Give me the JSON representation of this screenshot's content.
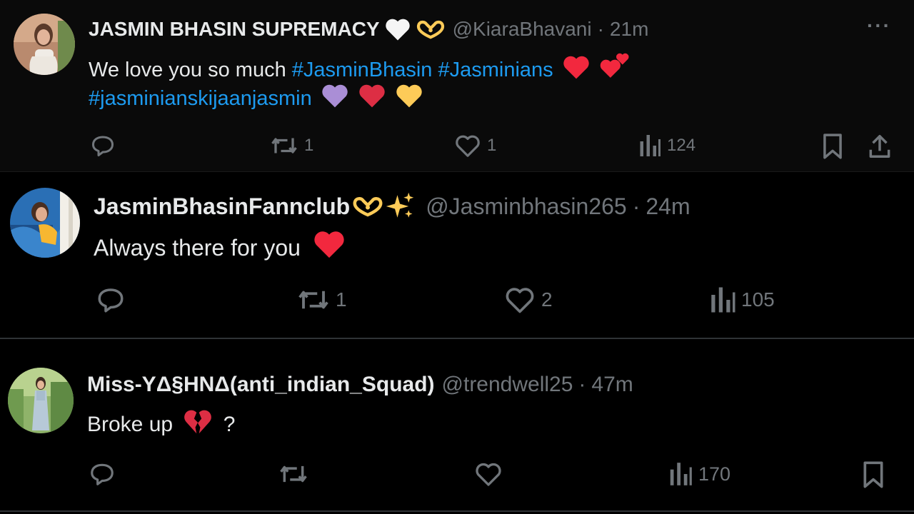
{
  "tweets": [
    {
      "name": "JASMIN BHASIN SUPREMACY",
      "name_emojis": [
        "white-heart",
        "heart-hands"
      ],
      "handle": "@KiaraBhavani",
      "separator": "·",
      "time": "21m",
      "more_label": "···",
      "text_line1": "We love you so much",
      "hashtags_line1": [
        "#JasminBhasin",
        "#Jasminians"
      ],
      "hashtag_line2": "#jasminianskijaanjasmin",
      "line_emojis": [
        "red-heart",
        "two-hearts",
        "purple-heart",
        "red-heart",
        "yellow-heart"
      ],
      "retweets": "1",
      "likes": "1",
      "views": "124"
    },
    {
      "name": "JasminBhasinFannclub",
      "name_emojis": [
        "heart-hands",
        "sparkles"
      ],
      "handle": "@Jasminbhasin265",
      "separator": "·",
      "time": "24m",
      "text": "Always there for you",
      "line_emojis": [
        "red-heart"
      ],
      "retweets": "1",
      "likes": "2",
      "views": "105"
    },
    {
      "name": "Miss-YΔ§HNΔ(anti_indian_Squad)",
      "handle": "@trendwell25",
      "separator": "·",
      "time": "47m",
      "text": "Broke up",
      "text_suffix": "?",
      "line_emojis": [
        "broken-heart"
      ],
      "views": "170"
    }
  ],
  "colors": {
    "background": "#000000",
    "text": "#e7e9ea",
    "muted": "#71767b",
    "hashtag": "#1d9bf0",
    "heart_red": "#f2283e",
    "heart_purple": "#aa8ed6",
    "heart_yellow": "#fdcb58"
  }
}
